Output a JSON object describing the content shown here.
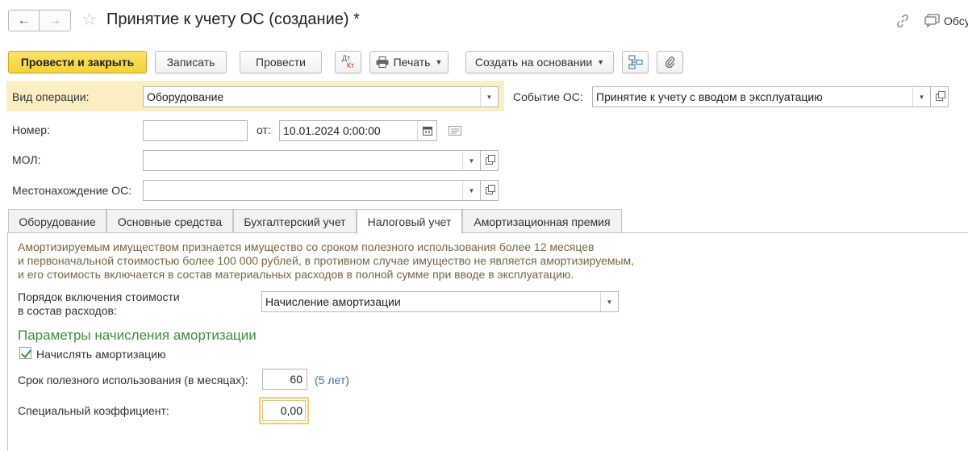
{
  "header": {
    "back_label": "←",
    "forward_label": "→",
    "title": "Принятие к учету ОС (создание) *",
    "discuss_label": "Обсу"
  },
  "toolbar": {
    "post_close_label": "Провести и закрыть",
    "save_label": "Записать",
    "post_label": "Провести",
    "dtkt_top": "Дт",
    "dtkt_bottom": "Кт",
    "print_label": "Печать",
    "create_based_label": "Создать на основании"
  },
  "form": {
    "operation_label": "Вид операции:",
    "operation_value": "Оборудование",
    "event_label": "Событие ОС:",
    "event_value": "Принятие к учету с вводом в эксплуатацию",
    "number_label": "Номер:",
    "number_value": "",
    "date_label": "от:",
    "date_value": "10.01.2024  0:00:00",
    "mol_label": "МОЛ:",
    "mol_value": "",
    "location_label": "Местонахождение ОС:",
    "location_value": ""
  },
  "tabs": [
    {
      "label": "Оборудование"
    },
    {
      "label": "Основные средства"
    },
    {
      "label": "Бухгалтерский учет"
    },
    {
      "label": "Налоговый учет"
    },
    {
      "label": "Амортизационная премия"
    }
  ],
  "tax": {
    "info_lines": [
      "Амортизируемым имуществом признается имущество со сроком полезного использования более 12 месяцев",
      "и первоначальной стоимостью более 100 000 рублей, в противном случае имущество не является амортизируемым,",
      "и его стоимость включается в состав материальных расходов в полной сумме при вводе в эксплуатацию."
    ],
    "order_label_line1": "Порядок включения стоимости",
    "order_label_line2": "в состав расходов:",
    "order_value": "Начисление амортизации",
    "section_title": "Параметры начисления амортизации",
    "accrue_label": "Начислять амортизацию",
    "accrue_checked": true,
    "life_label": "Срок полезного использования (в месяцах):",
    "life_value": "60",
    "life_hint": "(5 лет)",
    "coef_label": "Специальный коэффициент:",
    "coef_value": "0,00"
  },
  "colors": {
    "primary": "#f4d13a",
    "section": "#3d8d3d",
    "info_text": "#7a6640",
    "hint": "#3a6fa8",
    "highlight": "#fbeec2"
  },
  "icons": {
    "favorite": "star-icon",
    "link": "link-icon",
    "discuss": "chat-icon",
    "print": "printer-icon",
    "structure": "structure-icon",
    "attach": "paperclip-icon",
    "calendar": "calendar-icon",
    "comment": "comment-icon"
  }
}
